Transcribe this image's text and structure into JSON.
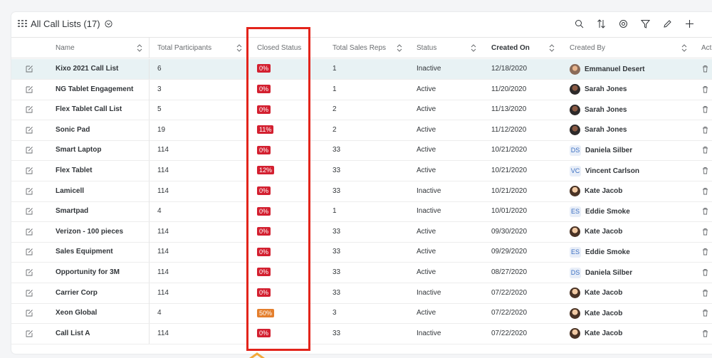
{
  "toolbar": {
    "title": "All Call Lists",
    "count": "(17)",
    "tools": [
      "search-icon",
      "sort-icon",
      "settings-icon",
      "filter-icon",
      "edit-icon",
      "add-icon"
    ]
  },
  "columns": {
    "name": "Name",
    "participants": "Total Participants",
    "closed": "Closed Status",
    "reps": "Total Sales Reps",
    "status": "Status",
    "created_on": "Created On",
    "created_by": "Created By",
    "actions": "Act"
  },
  "rows": [
    {
      "name": "Kixo 2021 Call List",
      "participants": "6",
      "closed": "0%",
      "reps": "1",
      "status": "Inactive",
      "created_on": "12/18/2020",
      "created_by": "Emmanuel Desert",
      "avatar": "photo3",
      "initials": ""
    },
    {
      "name": "NG Tablet Engagement",
      "participants": "3",
      "closed": "0%",
      "reps": "1",
      "status": "Active",
      "created_on": "11/20/2020",
      "created_by": "Sarah Jones",
      "avatar": "photo",
      "initials": ""
    },
    {
      "name": "Flex Tablet Call List",
      "participants": "5",
      "closed": "0%",
      "reps": "2",
      "status": "Active",
      "created_on": "11/13/2020",
      "created_by": "Sarah Jones",
      "avatar": "photo",
      "initials": ""
    },
    {
      "name": "Sonic Pad",
      "participants": "19",
      "closed": "11%",
      "reps": "2",
      "status": "Active",
      "created_on": "11/12/2020",
      "created_by": "Sarah Jones",
      "avatar": "photo",
      "initials": ""
    },
    {
      "name": "Smart Laptop",
      "participants": "114",
      "closed": "0%",
      "reps": "33",
      "status": "Active",
      "created_on": "10/21/2020",
      "created_by": "Daniela Silber",
      "avatar": "init",
      "initials": "DS"
    },
    {
      "name": "Flex Tablet",
      "participants": "114",
      "closed": "12%",
      "reps": "33",
      "status": "Active",
      "created_on": "10/21/2020",
      "created_by": "Vincent Carlson",
      "avatar": "init",
      "initials": "VC"
    },
    {
      "name": "Lamicell",
      "participants": "114",
      "closed": "0%",
      "reps": "33",
      "status": "Inactive",
      "created_on": "10/21/2020",
      "created_by": "Kate Jacob",
      "avatar": "photo2",
      "initials": ""
    },
    {
      "name": "Smartpad",
      "participants": "4",
      "closed": "0%",
      "reps": "1",
      "status": "Inactive",
      "created_on": "10/01/2020",
      "created_by": "Eddie Smoke",
      "avatar": "init",
      "initials": "ES"
    },
    {
      "name": "Verizon - 100 pieces",
      "participants": "114",
      "closed": "0%",
      "reps": "33",
      "status": "Active",
      "created_on": "09/30/2020",
      "created_by": "Kate Jacob",
      "avatar": "photo2",
      "initials": ""
    },
    {
      "name": "Sales Equipment",
      "participants": "114",
      "closed": "0%",
      "reps": "33",
      "status": "Active",
      "created_on": "09/29/2020",
      "created_by": "Eddie Smoke",
      "avatar": "init",
      "initials": "ES"
    },
    {
      "name": "Opportunity for 3M",
      "participants": "114",
      "closed": "0%",
      "reps": "33",
      "status": "Active",
      "created_on": "08/27/2020",
      "created_by": "Daniela Silber",
      "avatar": "init",
      "initials": "DS"
    },
    {
      "name": "Carrier Corp",
      "participants": "114",
      "closed": "0%",
      "reps": "33",
      "status": "Inactive",
      "created_on": "07/22/2020",
      "created_by": "Kate Jacob",
      "avatar": "photo2",
      "initials": ""
    },
    {
      "name": "Xeon Global",
      "participants": "4",
      "closed": "50%",
      "reps": "3",
      "status": "Active",
      "created_on": "07/22/2020",
      "created_by": "Kate Jacob",
      "avatar": "photo2",
      "initials": ""
    },
    {
      "name": "Call List A",
      "participants": "114",
      "closed": "0%",
      "reps": "33",
      "status": "Inactive",
      "created_on": "07/22/2020",
      "created_by": "Kate Jacob",
      "avatar": "photo2",
      "initials": ""
    }
  ],
  "colors": {
    "badge_critical": "#d32030",
    "badge_warning": "#e47f2d",
    "highlight": "#e3241b",
    "selected_row": "#e8f2f4"
  }
}
